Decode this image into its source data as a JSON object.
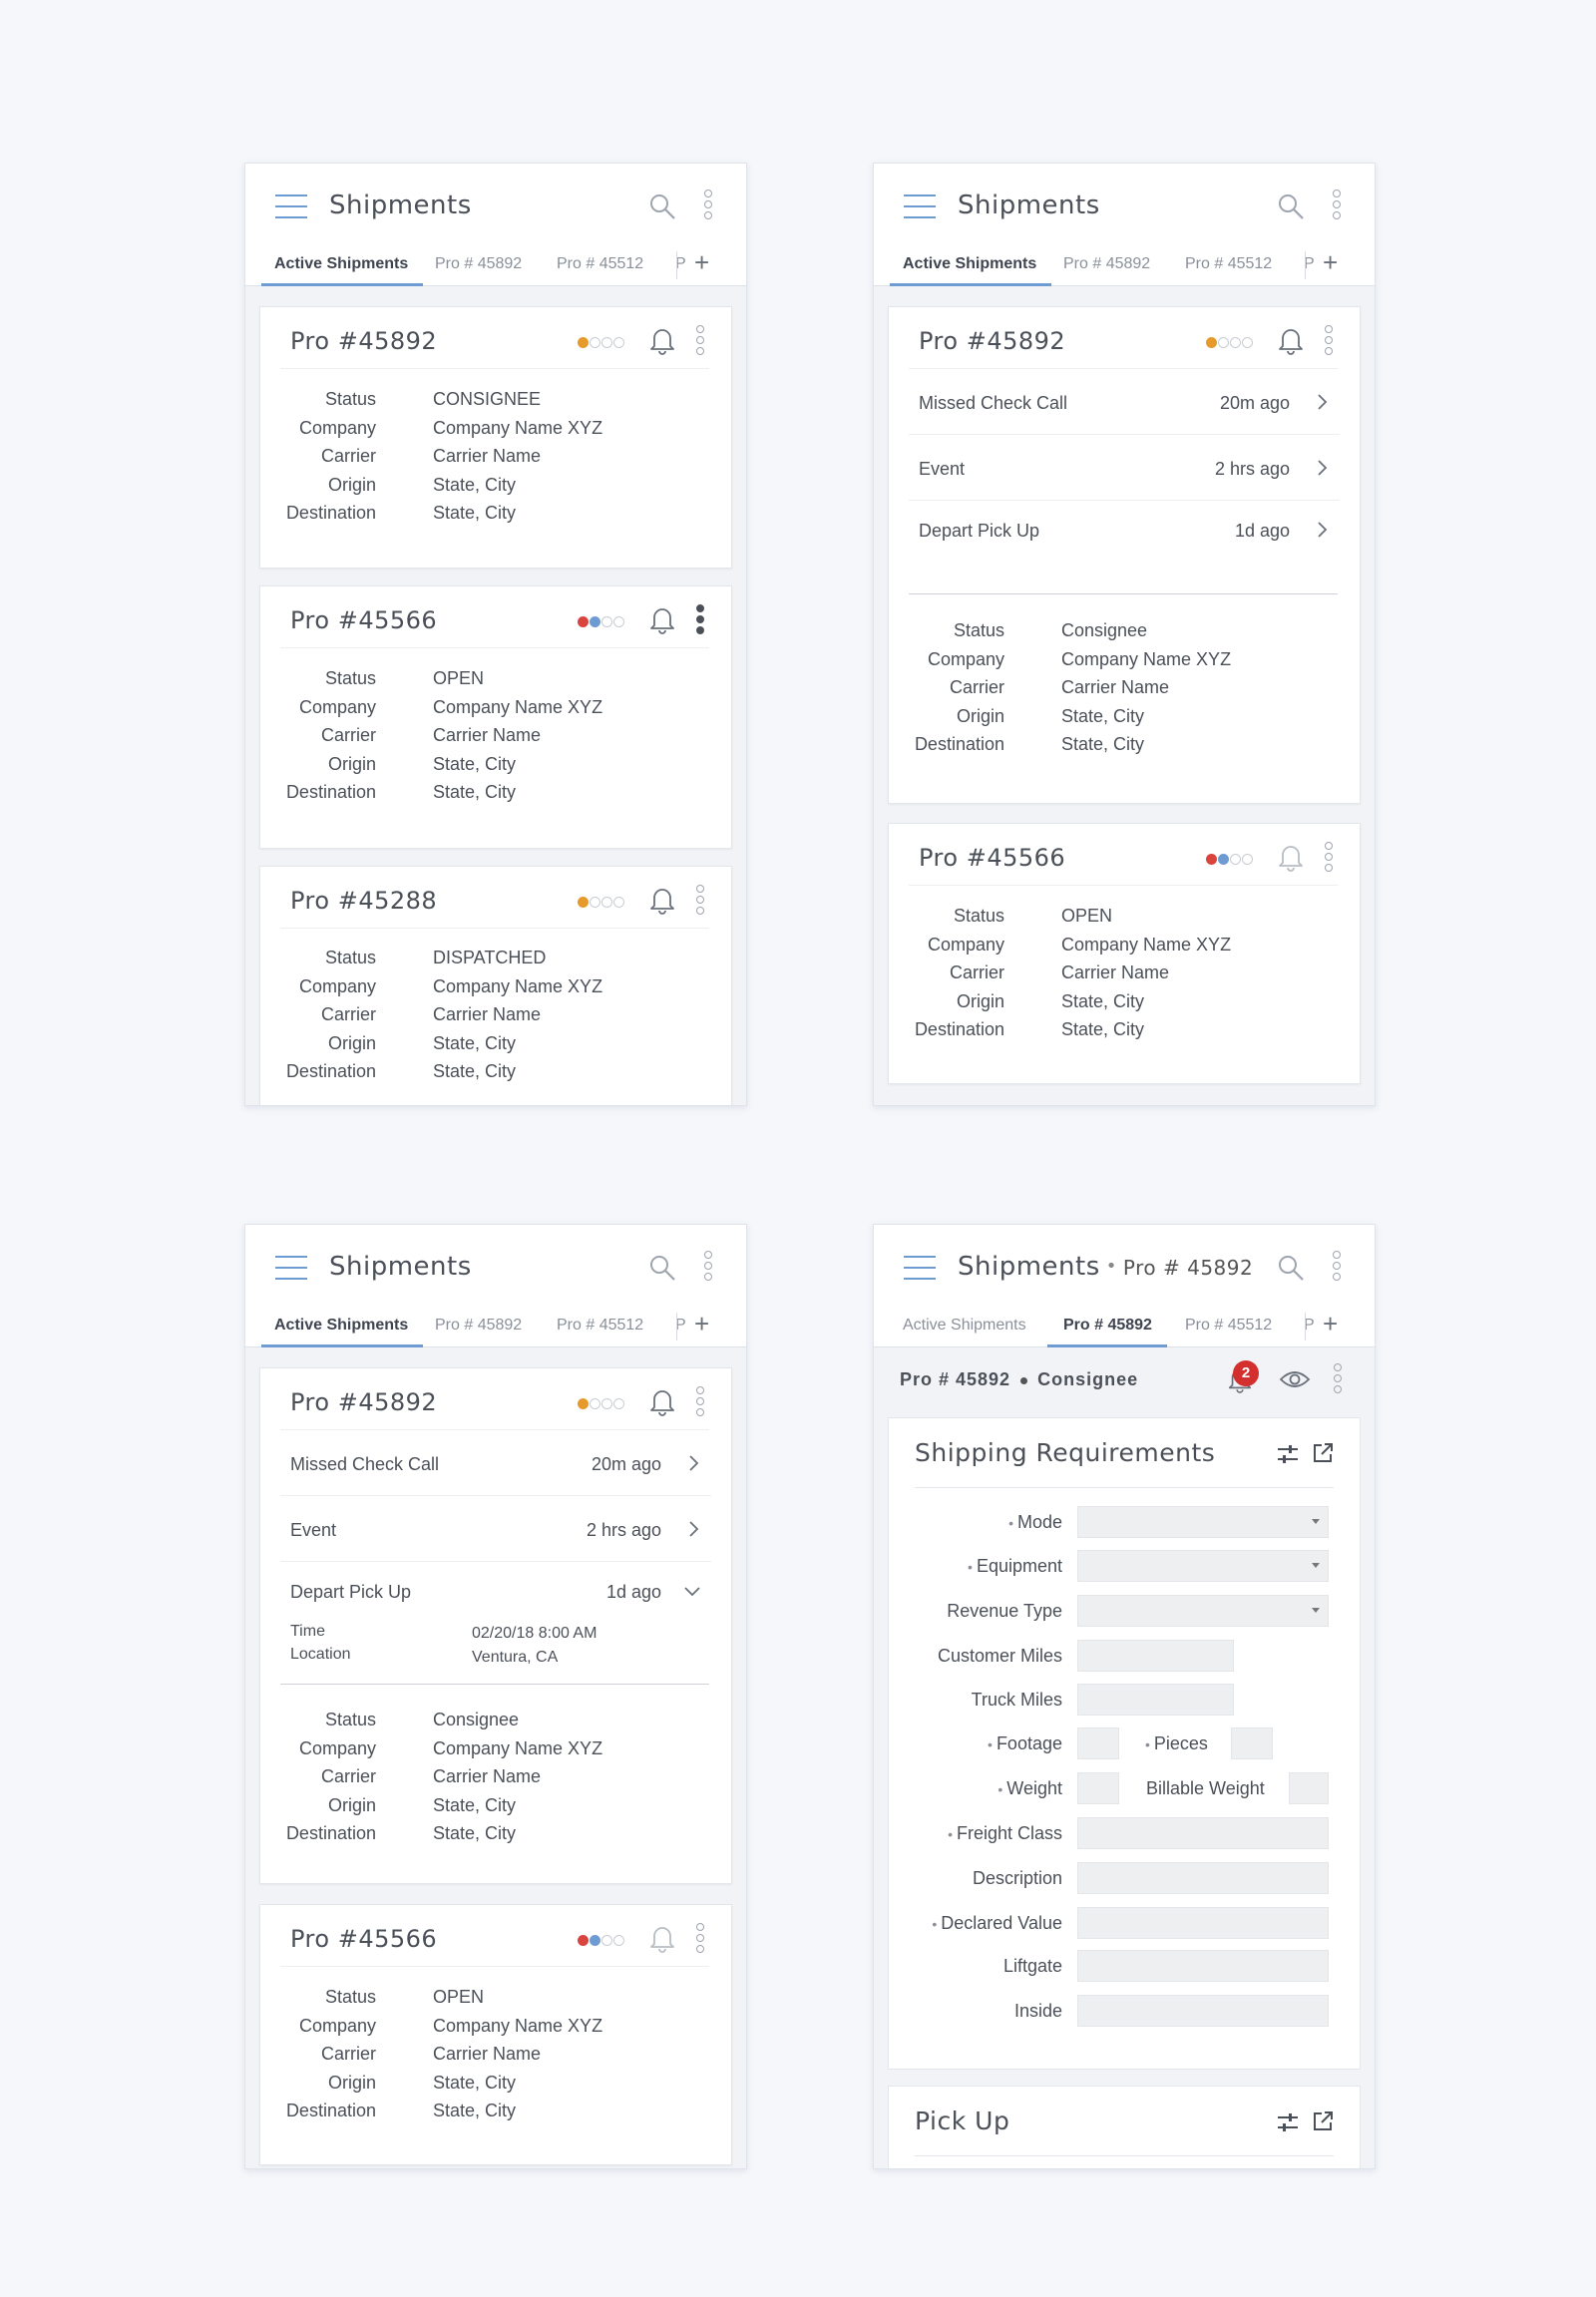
{
  "app": {
    "title": "Shipments",
    "tabs": [
      "Active Shipments",
      "Pro # 45892",
      "Pro # 45512",
      "P"
    ],
    "plus": "+"
  },
  "colors": {
    "accent": "#6f9bd3",
    "orange": "#e59a2b",
    "red": "#d9443f",
    "badge": "#d32f2f"
  },
  "labels": {
    "status": "Status",
    "company": "Company",
    "carrier": "Carrier",
    "origin": "Origin",
    "destination": "Destination"
  },
  "screen1": {
    "cards": [
      {
        "title": "Pro #45892",
        "dots": [
          "orange",
          "empty",
          "empty",
          "empty"
        ],
        "status": "CONSIGNEE",
        "company": "Company Name XYZ",
        "carrier": "Carrier Name",
        "origin": "State, City",
        "destination": "State, City"
      },
      {
        "title": "Pro #45566",
        "dots": [
          "red",
          "blue",
          "empty",
          "empty"
        ],
        "status": "OPEN",
        "company": "Company Name XYZ",
        "carrier": "Carrier Name",
        "origin": "State, City",
        "destination": "State, City"
      },
      {
        "title": "Pro #45288",
        "dots": [
          "orange",
          "empty",
          "empty",
          "empty"
        ],
        "status": "DISPATCHED",
        "company": "Company Name XYZ",
        "carrier": "Carrier Name",
        "origin": "State, City",
        "destination": "State, City"
      }
    ]
  },
  "screen2": {
    "card1": {
      "title": "Pro #45892",
      "events": [
        {
          "label": "Missed Check Call",
          "time": "20m ago"
        },
        {
          "label": "Event",
          "time": "2 hrs ago"
        },
        {
          "label": "Depart Pick Up",
          "time": "1d ago"
        }
      ],
      "status": "Consignee",
      "company": "Company Name XYZ",
      "carrier": "Carrier Name",
      "origin": "State, City",
      "destination": "State, City"
    },
    "card2": {
      "title": "Pro #45566",
      "status": "OPEN",
      "company": "Company Name XYZ",
      "carrier": "Carrier Name",
      "origin": "State, City",
      "destination": "State, City"
    }
  },
  "screen3": {
    "card1": {
      "title": "Pro #45892",
      "events": [
        {
          "label": "Missed Check Call",
          "time": "20m ago"
        },
        {
          "label": "Event",
          "time": "2 hrs ago"
        },
        {
          "label": "Depart Pick Up",
          "time": "1d ago"
        }
      ],
      "expanded": {
        "time_label": "Time",
        "time_value": "02/20/18  8:00 AM",
        "location_label": "Location",
        "location_value": "Ventura, CA"
      },
      "status": "Consignee",
      "company": "Company Name XYZ",
      "carrier": "Carrier Name",
      "origin": "State, City",
      "destination": "State, City"
    },
    "card2": {
      "title": "Pro #45566",
      "status": "OPEN",
      "company": "Company Name XYZ",
      "carrier": "Carrier Name",
      "origin": "State, City",
      "destination": "State, City"
    }
  },
  "screen4": {
    "title_sep": "•",
    "title_sub": "Pro # 45892",
    "sub_pro": "Pro # 45892",
    "sub_status": "Consignee",
    "notification_count": "2",
    "shipping_title": "Shipping Requirements",
    "fields": {
      "mode": "Mode",
      "equipment": "Equipment",
      "revenue_type": "Revenue Type",
      "customer_miles": "Customer Miles",
      "truck_miles": "Truck Miles",
      "footage": "Footage",
      "pieces": "Pieces",
      "weight": "Weight",
      "billable_weight": "Billable Weight",
      "freight_class": "Freight Class",
      "description": "Description",
      "declared_value": "Declared Value",
      "liftgate": "Liftgate",
      "inside": "Inside"
    },
    "required_mark": "•",
    "pickup_title": "Pick Up"
  }
}
